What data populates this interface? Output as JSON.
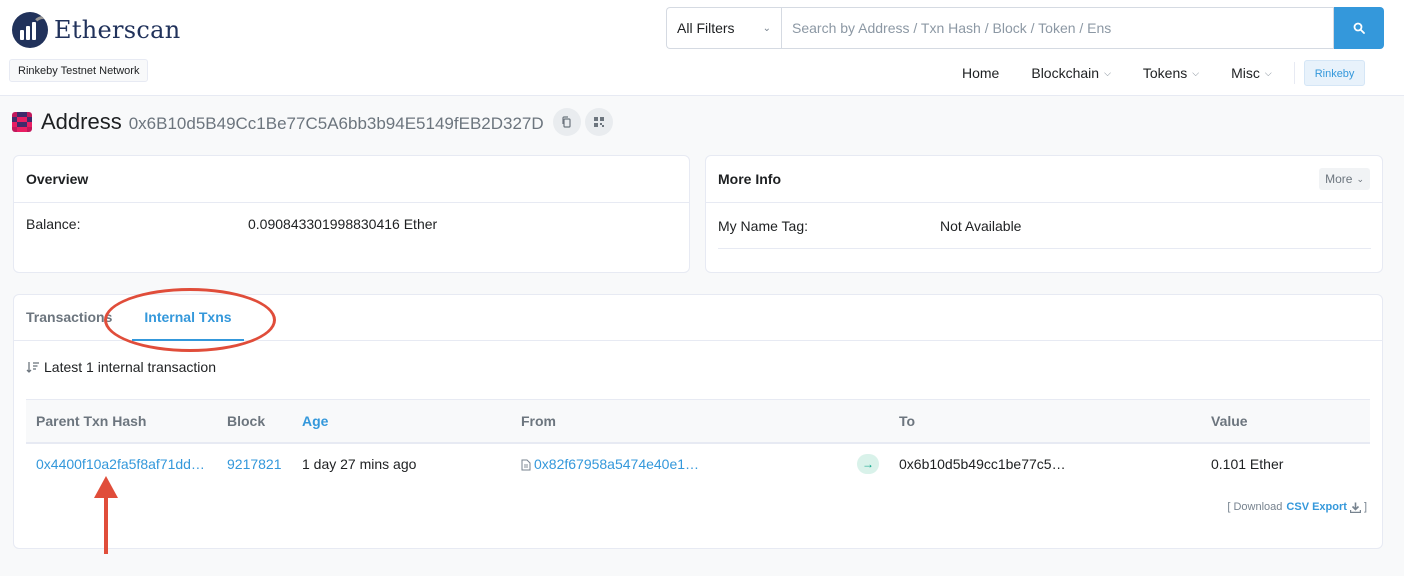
{
  "header": {
    "logo_text": "Etherscan",
    "network_badge": "Rinkeby Testnet Network",
    "search": {
      "filter_label": "All Filters",
      "placeholder": "Search by Address / Txn Hash / Block / Token / Ens"
    },
    "nav": {
      "home": "Home",
      "blockchain": "Blockchain",
      "tokens": "Tokens",
      "misc": "Misc",
      "network": "Rinkeby"
    }
  },
  "address": {
    "label": "Address",
    "hash": "0x6B10d5B49Cc1Be77C5A6bb3b94E5149fEB2D327D"
  },
  "overview": {
    "title": "Overview",
    "balance_label": "Balance:",
    "balance_value": "0.090843301998830416 Ether"
  },
  "more_info": {
    "title": "More Info",
    "more_button": "More",
    "name_tag_label": "My Name Tag:",
    "name_tag_value": "Not Available"
  },
  "tabs": {
    "transactions": "Transactions",
    "internal": "Internal Txns"
  },
  "latest_text": "Latest 1 internal transaction",
  "table": {
    "headers": {
      "parent_hash": "Parent Txn Hash",
      "block": "Block",
      "age": "Age",
      "from": "From",
      "to": "To",
      "value": "Value"
    },
    "rows": [
      {
        "parent_hash": "0x4400f10a2fa5f8af71dd…",
        "block": "9217821",
        "age": "1 day 27 mins ago",
        "from": "0x82f67958a5474e40e1…",
        "to": "0x6b10d5b49cc1be77c5…",
        "value": "0.101 Ether"
      }
    ]
  },
  "export": {
    "prefix": "[ Download",
    "link": "CSV Export",
    "suffix": "]"
  },
  "colors": {
    "accent": "#3498db",
    "annotation": "#e04d3a",
    "logo": "#21325b"
  }
}
